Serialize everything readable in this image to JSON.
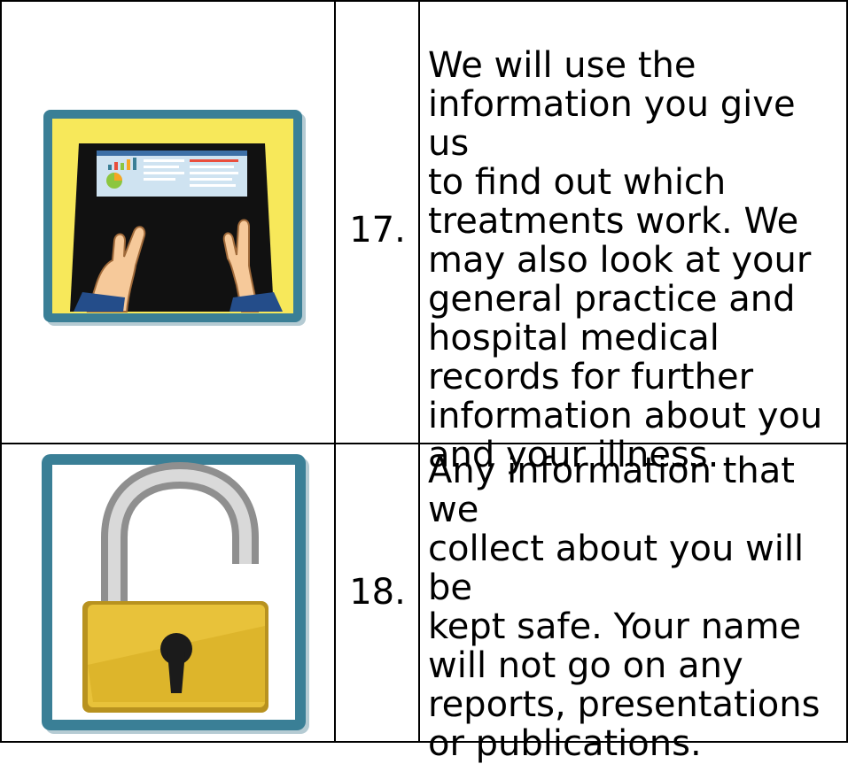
{
  "rows": [
    {
      "number": "17.",
      "text": "We will use the\ninformation you give us\nto find out which\ntreatments work. We\nmay also look at your\ngeneral practice and\nhospital medical\nrecords for further\ninformation about you\nand your illness.",
      "image_icon": "laptop-typing-icon"
    },
    {
      "number": "18.",
      "text": "Any information that we\ncollect about you will be\nkept safe. Your name\nwill not go on any\nreports, presentations\nor publications.",
      "image_icon": "padlock-icon"
    }
  ],
  "colors": {
    "frame": "#3a7f96",
    "laptop_bg": "#f7e85a",
    "lock_body": "#e8c23a"
  }
}
